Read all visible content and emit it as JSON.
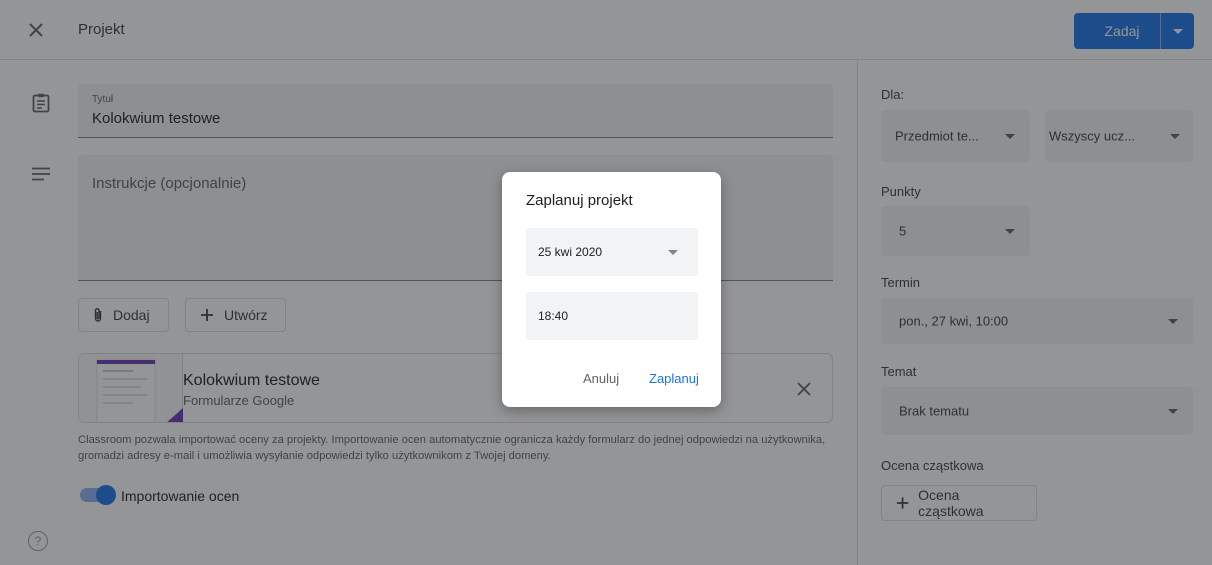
{
  "header": {
    "title": "Projekt",
    "assign_label": "Zadaj",
    "accent": "#1a73e8"
  },
  "main": {
    "title_label": "Tytuł",
    "title_value": "Kolokwium testowe",
    "instructions_placeholder": "Instrukcje (opcjonalnie)",
    "add_button": "Dodaj",
    "create_button": "Utwórz",
    "attachment": {
      "title": "Kolokwium testowe",
      "subtitle": "Formularze Google"
    },
    "info_text": "Classroom pozwala importować oceny za projekty. Importowanie ocen automatycznie ogranicza każdy formularz do jednej odpowiedzi na użytkownika, gromadzi adresy e-mail i umożliwia wysyłanie odpowiedzi tylko użytkownikom z Twojej domeny.",
    "import_grades_label": "Importowanie ocen",
    "import_grades_on": true,
    "help_icon_glyph": "?"
  },
  "sidebar": {
    "for_label": "Dla:",
    "class_select": "Przedmiot te...",
    "students_select": "Wszyscy ucz...",
    "points_label": "Punkty",
    "points_value": "5",
    "due_label": "Termin",
    "due_value": "pon., 27 kwi, 10:00",
    "topic_label": "Temat",
    "topic_value": "Brak tematu",
    "partial_grade_label": "Ocena cząstkowa",
    "partial_grade_button": "Ocena cząstkowa"
  },
  "dialog": {
    "title": "Zaplanuj projekt",
    "date_value": "25 kwi 2020",
    "time_value": "18:40",
    "cancel_label": "Anuluj",
    "confirm_label": "Zaplanuj"
  }
}
